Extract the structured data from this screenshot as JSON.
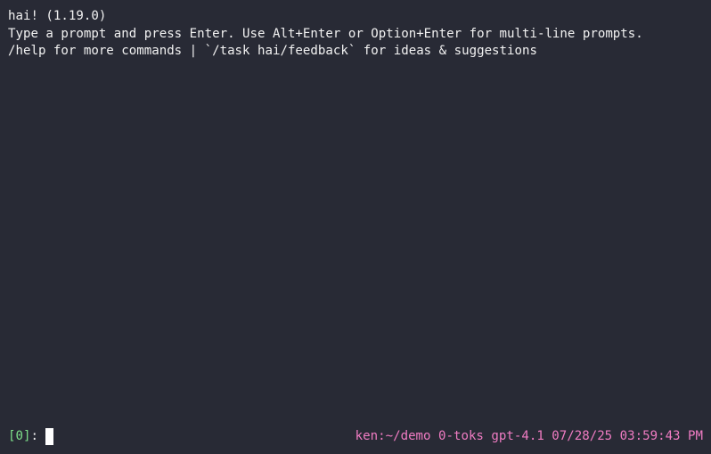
{
  "colors": {
    "background": "#282a35",
    "text": "#f2f2f2",
    "prompt_index": "#7ee08a",
    "status": "#f07cc3",
    "cursor": "#ffffff"
  },
  "output": {
    "lines": [
      "hai! (1.19.0)",
      "Type a prompt and press Enter. Use Alt+Enter or Option+Enter for multi-line prompts.",
      "/help for more commands | `/task hai/feedback` for ideas & suggestions"
    ]
  },
  "prompt": {
    "index_label": "[0]",
    "separator": ":",
    "input_value": ""
  },
  "status_bar": {
    "text": "ken:~/demo 0-toks gpt-4.1 07/28/25 03:59:43 PM"
  }
}
